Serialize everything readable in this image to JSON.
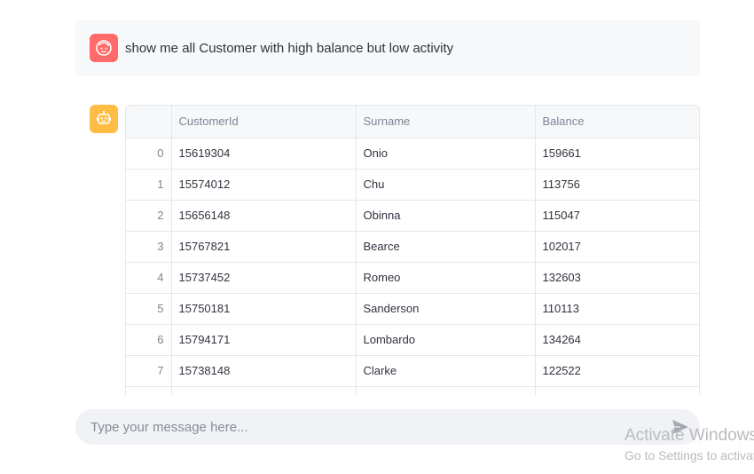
{
  "user_message": {
    "text": "show me all Customer with high balance but low activity",
    "avatar_icon": "user-face-icon",
    "avatar_color": "#ff6b6b"
  },
  "assistant": {
    "avatar_icon": "robot-icon",
    "avatar_color": "#ffbd45",
    "table": {
      "columns": [
        "",
        "CustomerId",
        "Surname",
        "Balance"
      ],
      "rows": [
        {
          "index": "0",
          "customer_id": "15619304",
          "surname": "Onio",
          "balance": "159661"
        },
        {
          "index": "1",
          "customer_id": "15574012",
          "surname": "Chu",
          "balance": "113756"
        },
        {
          "index": "2",
          "customer_id": "15656148",
          "surname": "Obinna",
          "balance": "115047"
        },
        {
          "index": "3",
          "customer_id": "15767821",
          "surname": "Bearce",
          "balance": "102017"
        },
        {
          "index": "4",
          "customer_id": "15737452",
          "surname": "Romeo",
          "balance": "132603"
        },
        {
          "index": "5",
          "customer_id": "15750181",
          "surname": "Sanderson",
          "balance": "110113"
        },
        {
          "index": "6",
          "customer_id": "15794171",
          "surname": "Lombardo",
          "balance": "134264"
        },
        {
          "index": "7",
          "customer_id": "15738148",
          "surname": "Clarke",
          "balance": "122522"
        },
        {
          "index": "",
          "customer_id": "",
          "surname": "",
          "balance": ""
        }
      ]
    }
  },
  "chat_input": {
    "placeholder": "Type your message here...",
    "value": "",
    "send_icon": "send-icon"
  },
  "watermark": {
    "line1": "Activate Windows",
    "line2": "Go to Settings to activate Windows."
  }
}
